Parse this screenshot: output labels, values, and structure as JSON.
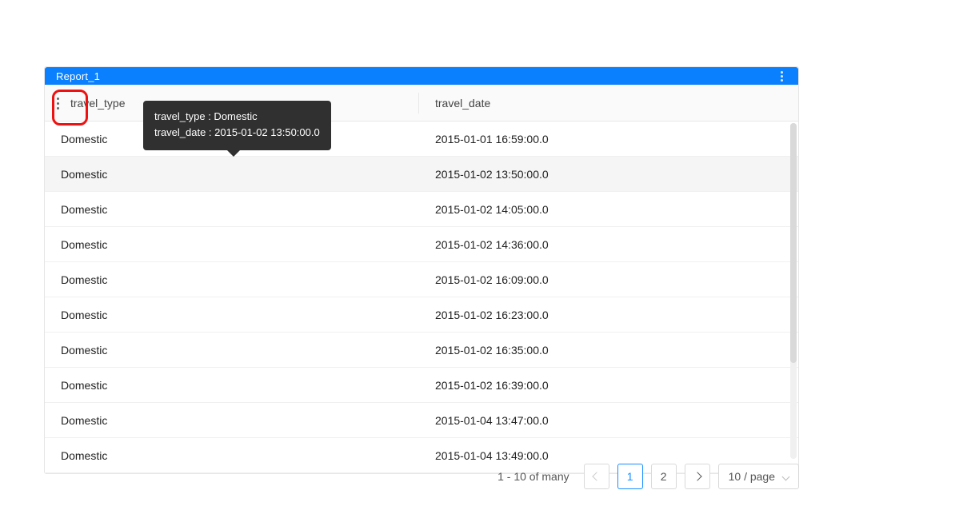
{
  "report": {
    "title": "Report_1"
  },
  "columns": {
    "col1": "travel_type",
    "col2": "travel_date"
  },
  "rows": [
    {
      "type": "Domestic",
      "date": "2015-01-01 16:59:00.0"
    },
    {
      "type": "Domestic",
      "date": "2015-01-02 13:50:00.0"
    },
    {
      "type": "Domestic",
      "date": "2015-01-02 14:05:00.0"
    },
    {
      "type": "Domestic",
      "date": "2015-01-02 14:36:00.0"
    },
    {
      "type": "Domestic",
      "date": "2015-01-02 16:09:00.0"
    },
    {
      "type": "Domestic",
      "date": "2015-01-02 16:23:00.0"
    },
    {
      "type": "Domestic",
      "date": "2015-01-02 16:35:00.0"
    },
    {
      "type": "Domestic",
      "date": "2015-01-02 16:39:00.0"
    },
    {
      "type": "Domestic",
      "date": "2015-01-04 13:47:00.0"
    },
    {
      "type": "Domestic",
      "date": "2015-01-04 13:49:00.0"
    }
  ],
  "tooltip": {
    "line1": "travel_type : Domestic",
    "line2": "travel_date : 2015-01-02 13:50:00.0"
  },
  "pager": {
    "range": "1 - 10 of many",
    "page1": "1",
    "page2": "2",
    "size": "10 / page"
  },
  "hovered_row_index": 1
}
